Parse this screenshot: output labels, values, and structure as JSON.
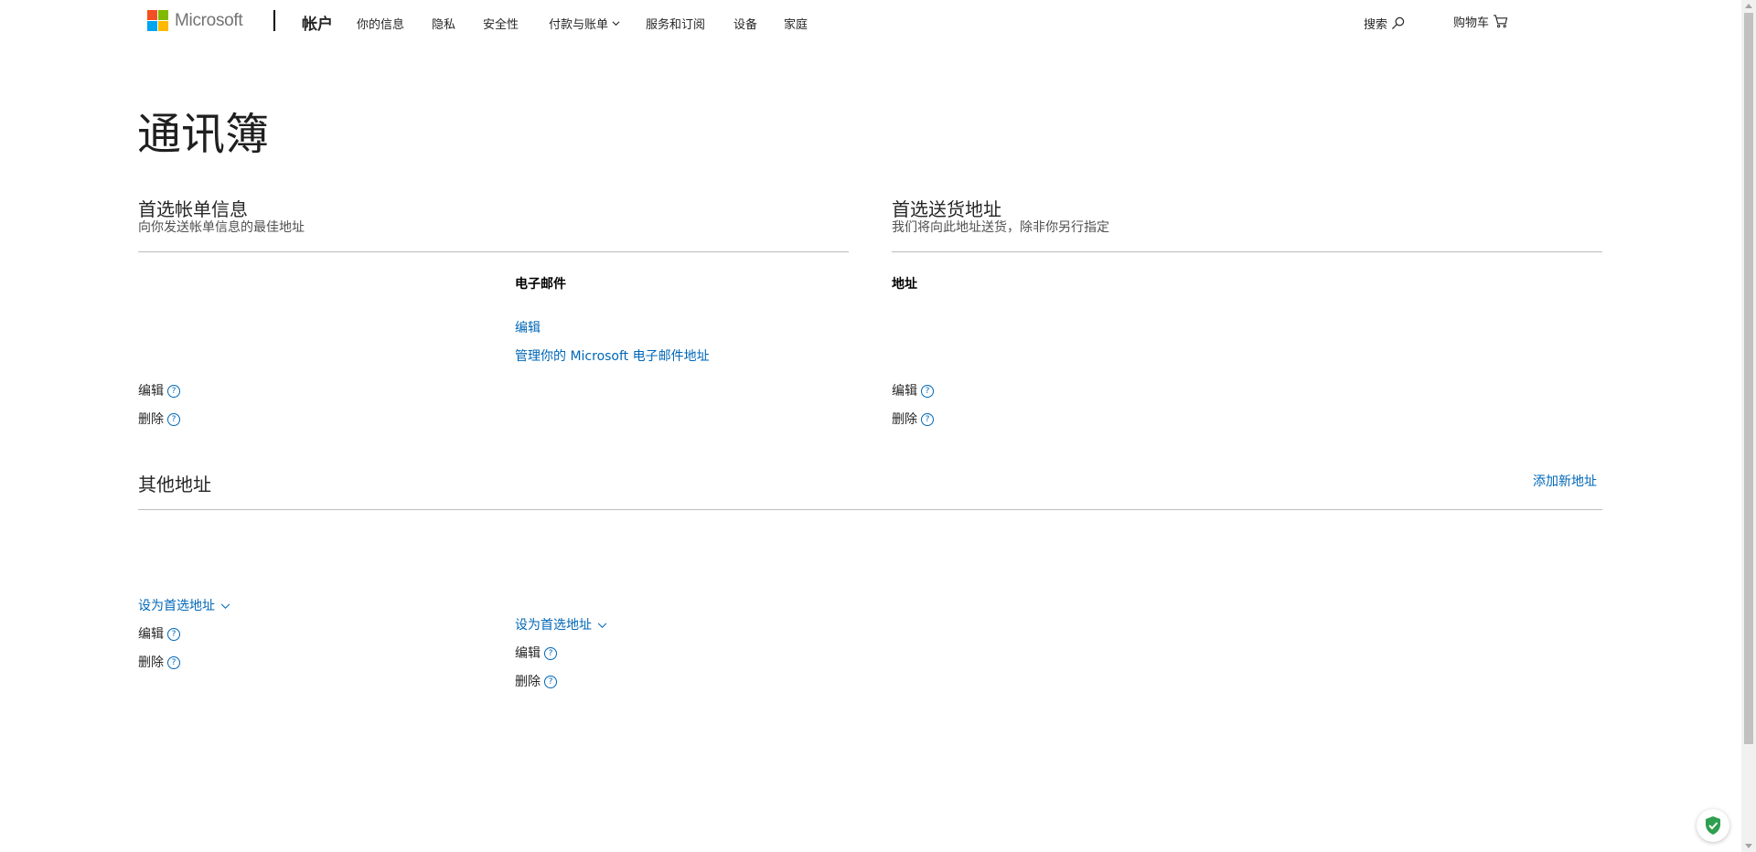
{
  "header": {
    "logo_text": "Microsoft",
    "brand": "帐户",
    "nav": [
      {
        "label": "你的信息"
      },
      {
        "label": "隐私"
      },
      {
        "label": "安全性"
      },
      {
        "label": "付款与账单"
      },
      {
        "label": "服务和订阅"
      },
      {
        "label": "设备"
      },
      {
        "label": "家庭"
      }
    ],
    "search_label": "搜索",
    "cart_label": "购物车",
    "logo_colors": [
      "#f25022",
      "#7fba00",
      "#00a4ef",
      "#ffb900"
    ]
  },
  "page": {
    "title": "通讯簿"
  },
  "billing": {
    "title": "首选帐单信息",
    "subtitle": "向你发送帐单信息的最佳地址",
    "email_heading": "电子邮件",
    "email_edit": "编辑",
    "email_manage": "管理你的 Microsoft 电子邮件地址",
    "edit": "编辑",
    "delete": "删除"
  },
  "shipping": {
    "title": "首选送货地址",
    "subtitle": "我们将向此地址送货，除非你另行指定",
    "address_heading": "地址",
    "edit": "编辑",
    "delete": "删除"
  },
  "other": {
    "title": "其他地址",
    "add_new": "添加新地址",
    "addresses": [
      {
        "set_preferred": "设为首选地址",
        "edit": "编辑",
        "delete": "删除"
      },
      {
        "set_preferred": "设为首选地址",
        "edit": "编辑",
        "delete": "删除"
      }
    ]
  },
  "help_glyph": "?",
  "colors": {
    "link": "#0067b8",
    "text": "#262626",
    "rule": "#bdbdbd",
    "shield_green": "#2e9f4e"
  }
}
